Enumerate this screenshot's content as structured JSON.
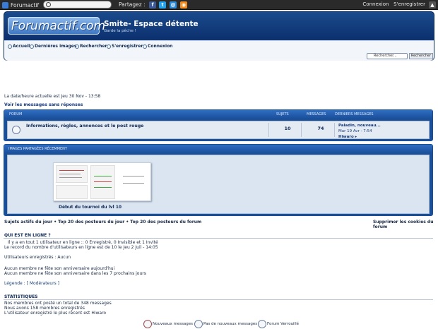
{
  "topbar": {
    "brand": "Forumactif",
    "partagez": "Partagez :",
    "connexion": "Connexion",
    "register": "S'enregistrer",
    "social": [
      {
        "name": "facebook-icon",
        "glyph": "f",
        "color": "#3b5998"
      },
      {
        "name": "twitter-icon",
        "glyph": "t",
        "color": "#1da1f2"
      },
      {
        "name": "email-icon",
        "glyph": "@",
        "color": "#2d8bd8"
      },
      {
        "name": "rss-icon",
        "glyph": "◉",
        "color": "#f28c1e"
      }
    ]
  },
  "header": {
    "logo_text": "Forumactif.com",
    "site_title": "Smite- Espace détente",
    "site_desc": "Garde la pêche !",
    "nav": [
      "Accueil",
      "Dernières images",
      "Rechercher",
      "S'enregistrer",
      "Connexion"
    ],
    "search_placeholder": "Rechercher...",
    "search_button": "Rechercher"
  },
  "datetime": "La date/heure actuelle est Jeu 30 Nov - 13:58",
  "unanswered_link": "Voir les messages sans réponses",
  "forum_table": {
    "headers": {
      "forum": "FORUM",
      "topics": "SUJETS",
      "messages": "MESSAGES",
      "last": "DERNIERS MESSAGES"
    },
    "rows": [
      {
        "name": "Informations, règles, annonces et le post rouge",
        "topics": "10",
        "messages": "74",
        "last_title": "Paladin, nouveau...",
        "last_date": "Mar 19 Avr - 7:54",
        "last_author": "Hiwaro"
      }
    ]
  },
  "images_box": {
    "header": "IMAGES PARTAGÉES RÉCEMMENT",
    "caption": "Début du tournoi du lvl 10"
  },
  "links_row": {
    "left": "Sujets actifs du jour • Top 20 des posteurs du jour • Top 20 des posteurs du forum",
    "right": "Supprimer les cookies du forum"
  },
  "online": {
    "title": "QUI EST EN LIGNE ?",
    "line1": "Il y a en tout 1 utilisateur en ligne :: 0 Enregistré, 0 Invisible et 1 Invité",
    "line2": "Le record du nombre d'utilisateurs en ligne est de 10 le Jeu 2 Juil - 14:05",
    "registered": "Utilisateurs enregistrés : Aucun",
    "bday_today": "Aucun membre ne fête son anniversaire aujourd'hui",
    "bday_week": "Aucun membre ne fête son anniversaire dans les 7 prochains jours",
    "legend": "Légende : [ Modérateurs ]"
  },
  "stats": {
    "title": "STATISTIQUES",
    "line1": "Nos membres ont posté un total de 348 messages",
    "line2": "Nous avons 158 membres enregistrés",
    "line3": "L'utilisateur enregistré le plus récent est Hiwaro"
  },
  "footer_legend": [
    "Nouveaux messages",
    "Pas de nouveaux messages",
    "Forum Verrouillé"
  ]
}
